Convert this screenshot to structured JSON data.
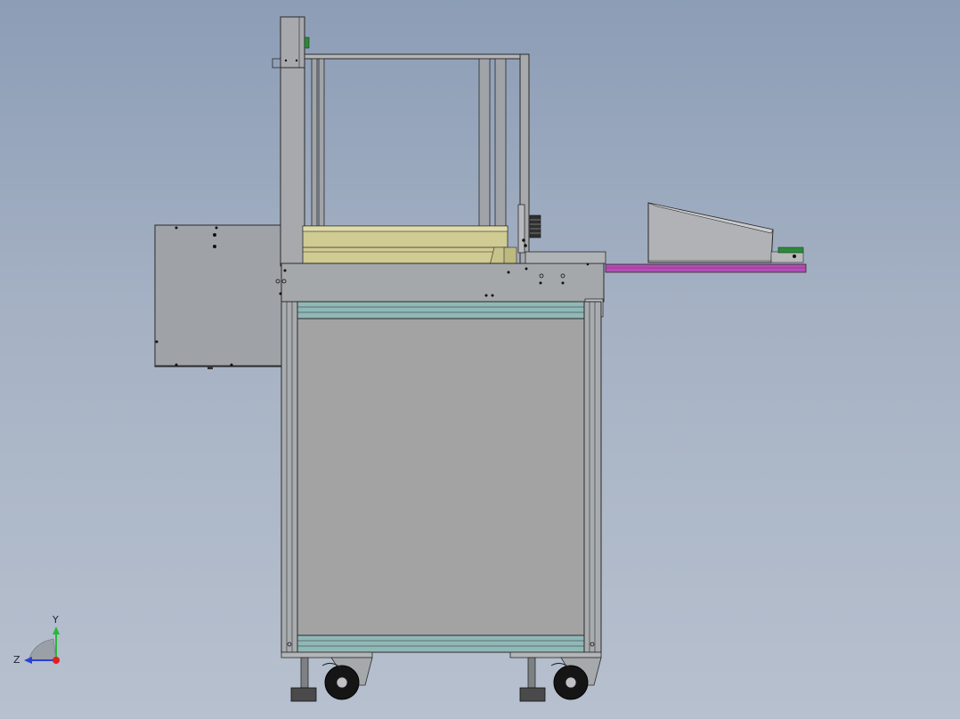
{
  "viewport": {
    "background_top": "#8c9db6",
    "background_bottom": "#b7c0ce"
  },
  "model": {
    "frame_color": "#a4a7ab",
    "panel_color": "#a3a3a3",
    "tray_color": "#d3d0a0",
    "rail_color": "#b44db4",
    "rail_accent_color": "#8fb8b6",
    "edge_color": "#2a2a2a",
    "green_part_color": "#2a8a3a"
  },
  "triad": {
    "y_label": "Y",
    "z_label": "Z",
    "y_color": "#27b83a",
    "z_color": "#2a3fd6",
    "x_color": "#e02020"
  }
}
